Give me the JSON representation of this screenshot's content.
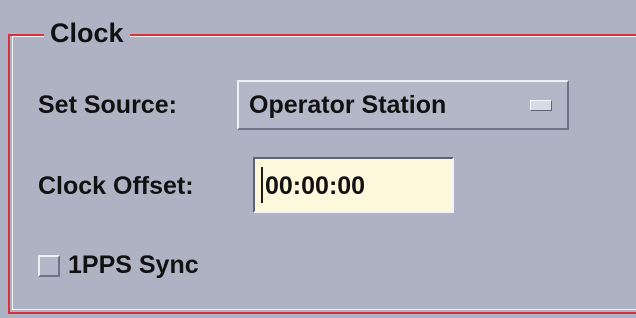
{
  "clock_group": {
    "title": "Clock",
    "set_source_label": "Set Source:",
    "set_source_value": "Operator Station",
    "clock_offset_label": "Clock Offset:",
    "clock_offset_value": "00:00:00",
    "pps_sync_label": "1PPS Sync",
    "pps_sync_checked": false
  },
  "colors": {
    "background": "#aeb2c3",
    "frame_border": "#d9323c",
    "field_background": "#fdf7dc"
  }
}
